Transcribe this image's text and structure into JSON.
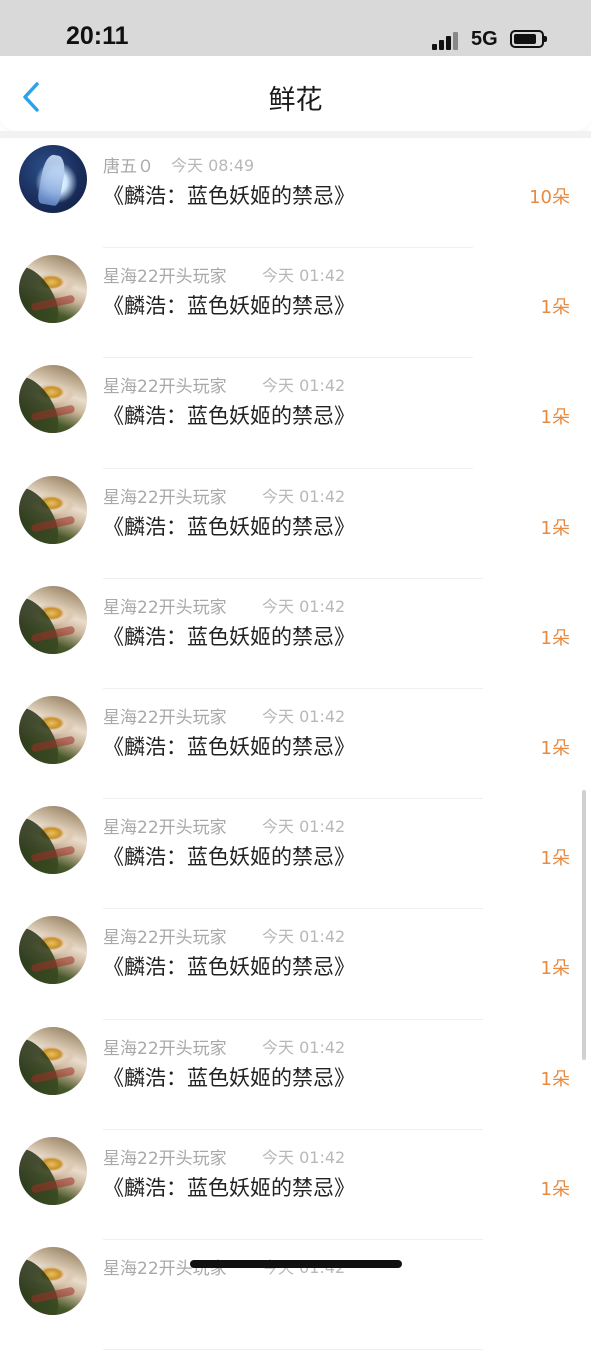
{
  "status_bar": {
    "time": "20:11",
    "network": "5G"
  },
  "nav": {
    "title": "鲜花"
  },
  "items": [
    {
      "user": "唐五０",
      "time": "今天 08:49",
      "book": "《麟浩：蓝色妖姬的禁忌》",
      "count": "10朵",
      "avatar": "avatar-b"
    },
    {
      "user": "星海22开头玩家",
      "time": "今天 01:42",
      "book": "《麟浩：蓝色妖姬的禁忌》",
      "count": "1朵",
      "avatar": "avatar-a"
    },
    {
      "user": "星海22开头玩家",
      "time": "今天 01:42",
      "book": "《麟浩：蓝色妖姬的禁忌》",
      "count": "1朵",
      "avatar": "avatar-a"
    },
    {
      "user": "星海22开头玩家",
      "time": "今天 01:42",
      "book": "《麟浩：蓝色妖姬的禁忌》",
      "count": "1朵",
      "avatar": "avatar-a"
    },
    {
      "user": "星海22开头玩家",
      "time": "今天 01:42",
      "book": "《麟浩：蓝色妖姬的禁忌》",
      "count": "1朵",
      "avatar": "avatar-a"
    },
    {
      "user": "星海22开头玩家",
      "time": "今天 01:42",
      "book": "《麟浩：蓝色妖姬的禁忌》",
      "count": "1朵",
      "avatar": "avatar-a"
    },
    {
      "user": "星海22开头玩家",
      "time": "今天 01:42",
      "book": "《麟浩：蓝色妖姬的禁忌》",
      "count": "1朵",
      "avatar": "avatar-a"
    },
    {
      "user": "星海22开头玩家",
      "time": "今天 01:42",
      "book": "《麟浩：蓝色妖姬的禁忌》",
      "count": "1朵",
      "avatar": "avatar-a"
    },
    {
      "user": "星海22开头玩家",
      "time": "今天 01:42",
      "book": "《麟浩：蓝色妖姬的禁忌》",
      "count": "1朵",
      "avatar": "avatar-a"
    },
    {
      "user": "星海22开头玩家",
      "time": "今天 01:42",
      "book": "《麟浩：蓝色妖姬的禁忌》",
      "count": "1朵",
      "avatar": "avatar-a"
    },
    {
      "user": "星海22开头玩家",
      "time": "今天 01:42",
      "book": "",
      "count": "",
      "avatar": "avatar-a"
    }
  ]
}
